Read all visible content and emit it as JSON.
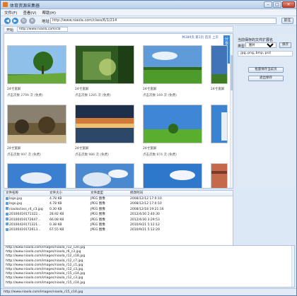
{
  "window": {
    "title": "体育资源采集器"
  },
  "menu": [
    "文件(F)",
    "查看(V)",
    "帮助(H)"
  ],
  "toolbar": {
    "address_label": "地址",
    "address_value": "http://www.niaola.com/class/6/1/214",
    "go_label": "前往"
  },
  "start_bar": {
    "start_label": "开始",
    "url_value": "http://www.niaola.com/cla"
  },
  "browser": {
    "pager_text": "共389页 第1页 首页 上页",
    "share_label": "分享"
  },
  "thumbs": [
    {
      "caption": "24寸宽屏",
      "meta": "点击次数 2799  次  (免费)"
    },
    {
      "caption": "24寸宽屏",
      "meta": "点击次数 1285  次  (免费)"
    },
    {
      "caption": "24寸宽屏",
      "meta": "点击次数 169  次  (免费)"
    },
    {
      "caption": "24寸宽屏",
      "meta": ""
    },
    {
      "caption": "24寸宽屏",
      "meta": "点击次数 997  次  (免费)"
    },
    {
      "caption": "24寸宽屏",
      "meta": "点击次数 986  次  (免费)"
    },
    {
      "caption": "24寸宽屏",
      "meta": "点击次数 874  次  (免费)"
    },
    {
      "caption": "",
      "meta": ""
    }
  ],
  "side": {
    "heading": "当前保存的文件扩展名",
    "type_label": "类型",
    "type_value": "图片",
    "save_label": "保存",
    "ext_value": ".jpg,.png,.bmp,.psd",
    "btn_batch": "批量保存当前页",
    "btn_exit": "退出保存"
  },
  "filelist": {
    "headers": [
      "文件名称",
      "文件大小",
      "文件类型",
      "修改时间"
    ],
    "rows": [
      {
        "name": "logo.jpg",
        "size": "4.78 KB",
        "type": "JPEG 图像",
        "time": "2008/12/12 17:0:10"
      },
      {
        "name": "logo.jpg",
        "size": "4.78 KB",
        "type": "JPEG 图像",
        "time": "2008/12/12 17:0:10"
      },
      {
        "name": "niaolaclass_r4_c3.jpg",
        "size": "0.30 KB",
        "type": "JPEG 图像",
        "time": "2008/12/18 19:21:16"
      },
      {
        "name": "20100419171322...",
        "size": "28.92 KB",
        "type": "JPEG 图像",
        "time": "2012/4/30 2:40:30"
      },
      {
        "name": "20100419172647...",
        "size": "66.08 KB",
        "type": "JPEG 图像",
        "time": "2012/4/30 3:29:53"
      },
      {
        "name": "20100419171321...",
        "size": "0.38 KB",
        "type": "JPEG 图像",
        "time": "2010/9/21 5:12:12"
      },
      {
        "name": "20100419172613...",
        "size": "67.55 KB",
        "type": "JPEG 图像",
        "time": "2010/9/21 5:12:29"
      }
    ]
  },
  "log": [
    "http://www.niaola.com/images/niaola_r12_c20.jpg",
    "http://www.niaola.com/images/niaola_r6_c3.jpg",
    "http://www.niaola.com/images/niaola_r12_c18.jpg",
    "http://www.niaola.com/images/niaola_r12_c7.jpg",
    "http://www.niaola.com/images/niaola_r12_c1.jpg",
    "http://www.niaola.com/images/niaola_r12_c3.jpg",
    "http://www.niaola.com/images/niaola_r15_c14.jpg",
    "http://www.niaola.com/images/niaola_r12_c3.jpg",
    "http://www.niaola.com/images/niaola_r15_c14.jpg"
  ],
  "status": "http://www.niaola.com/images/niaola_r15_c14.jpg"
}
